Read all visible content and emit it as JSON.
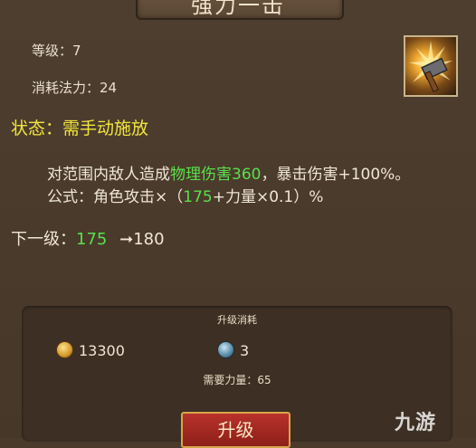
{
  "title": "强力一击",
  "stats": {
    "level_label": "等级：",
    "level": "7",
    "mana_label": "消耗法力：",
    "mana": "24"
  },
  "status": {
    "label": "状态：",
    "value": "需手动施放"
  },
  "description": {
    "l1_prefix": "对范围内敌人造成",
    "l1_highlight": "物理伤害360",
    "l1_suffix": "，暴击伤害+100%。",
    "l2_prefix": "公式：角色攻击×（",
    "l2_highlight": "175",
    "l2_suffix": "+力量×0.1）%"
  },
  "next_level": {
    "label": "下一级：",
    "current": "175",
    "arrow": "➞",
    "next": "180"
  },
  "upgrade": {
    "title": "升级消耗",
    "gold": "13300",
    "gem": "3",
    "req_label": "需要力量：",
    "req_value": "65",
    "button": "升级"
  },
  "watermark": "九游",
  "colors": {
    "highlight_green": "#58e04a",
    "status_yellow": "#f2e63b",
    "button_red": "#a8281f"
  },
  "icons": {
    "skill": "hammer-strike-icon",
    "gold": "gold-coin-icon",
    "gem": "gem-icon"
  }
}
